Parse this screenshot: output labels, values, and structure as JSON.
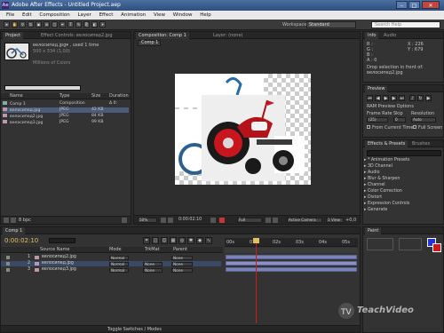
{
  "window": {
    "title": "Adobe After Effects - Untitled Project.aep",
    "min": "–",
    "max": "□",
    "close": "✕"
  },
  "menu": [
    "File",
    "Edit",
    "Composition",
    "Layer",
    "Effect",
    "Animation",
    "View",
    "Window",
    "Help"
  ],
  "toolbar": {
    "workspace_label": "Workspace:",
    "workspace_value": "Standard",
    "search_placeholder": "Search Help"
  },
  "project": {
    "tabs": [
      "Project",
      "Effect Controls: велосипед2.jpg"
    ],
    "preview_name": "велосипед.jpg▾ , used 1 time",
    "preview_dims": "500 x 334 (1,00)",
    "preview_colors": "Millions of Colors",
    "search_placeholder": "",
    "columns": {
      "name": "Name",
      "type": "Type",
      "size": "Size",
      "duration": "Duration"
    },
    "items": [
      {
        "name": "Comp 1",
        "type": "Composition",
        "size": "",
        "duration": "Δ 0:"
      },
      {
        "name": "велосипед.jpg",
        "type": "JPEG",
        "size": "42 KB",
        "duration": ""
      },
      {
        "name": "велосипед2.jpg",
        "type": "JPEG",
        "size": "84 KB",
        "duration": ""
      },
      {
        "name": "велосипед3.jpg",
        "type": "JPEG",
        "size": "99 KB",
        "duration": ""
      }
    ],
    "bpc": "8 bpc"
  },
  "composition": {
    "tabs": [
      "Composition: Comp 1",
      "Layer: (none)"
    ],
    "breadcrumb": "Comp 1",
    "zoom": "50%",
    "timecode": "0:00:02:10",
    "resolution": "Full",
    "camera": "Active Camera",
    "view": "1 View",
    "offset": "+0,0"
  },
  "info": {
    "tabs": [
      "Info",
      "Audio"
    ],
    "r": "R :",
    "g": "G :",
    "b": "B :",
    "a": "A : 0",
    "x": "X : 226",
    "y": "Y : 679",
    "msg1": "Drop selection in front of:",
    "msg2": "велосипед2.jpg"
  },
  "preview": {
    "tab": "Preview",
    "options": "RAM Preview Options",
    "frame_rate_label": "Frame Rate",
    "skip_label": "Skip",
    "resolution_label": "Resolution",
    "frame_rate": "(25)",
    "skip": "0",
    "resolution": "Auto",
    "from_current": "From Current Time",
    "full_screen": "Full Screen"
  },
  "effects": {
    "tabs": [
      "Effects & Presets",
      "Brushes"
    ],
    "search_placeholder": "",
    "items": [
      "* Animation Presets",
      "3D Channel",
      "Audio",
      "Blur & Sharpen",
      "Channel",
      "Color Correction",
      "Distort",
      "Expression Controls",
      "Generate"
    ]
  },
  "timeline": {
    "tabs": [
      "Comp 1"
    ],
    "timecode": "0:00:02:10",
    "ruler": [
      "00s",
      "01s",
      "02s",
      "03s",
      "04s",
      "05s"
    ],
    "header": {
      "source_name": "Source Name",
      "mode": "Mode",
      "trkmat": "TrkMat",
      "parent": "Parent"
    },
    "layers": [
      {
        "num": "1",
        "name": "велосипед2.jpg",
        "mode": "Normal",
        "trkmat": "",
        "parent": "None"
      },
      {
        "num": "2",
        "name": "велосипед.jpg",
        "mode": "Normal",
        "trkmat": "None",
        "parent": "None"
      },
      {
        "num": "3",
        "name": "велосипед3.jpg",
        "mode": "Normal",
        "trkmat": "None",
        "parent": "None"
      }
    ],
    "toggle": "Toggle Switches / Modes",
    "playhead_fraction": 0.232
  },
  "paint": {
    "tab": "Paint"
  },
  "watermark": "TeachVideo",
  "colors": {
    "red": "#d01818",
    "blue": "#2233dd",
    "bar": "#7a83b5"
  }
}
